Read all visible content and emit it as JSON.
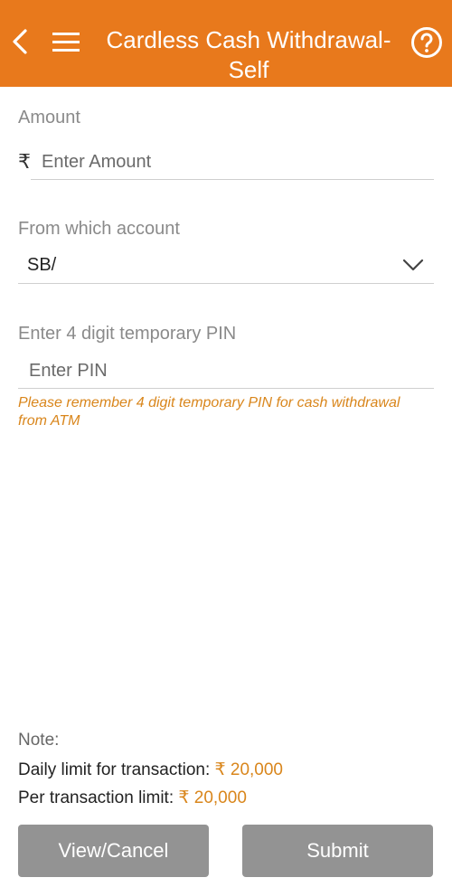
{
  "header": {
    "title": "Cardless Cash Withdrawal- Self",
    "back_icon": "chevron-left-icon",
    "menu_icon": "hamburger-menu-icon",
    "help_icon": "help-circle-icon",
    "bg_color": "#e8791c"
  },
  "amount": {
    "label": "Amount",
    "currency_symbol": "₹",
    "placeholder": "Enter Amount"
  },
  "account": {
    "label": "From which account",
    "selected": "SB/"
  },
  "pin": {
    "label": "Enter 4 digit temporary PIN",
    "placeholder": "Enter PIN",
    "hint": "Please remember 4 digit temporary PIN for cash withdrawal from ATM"
  },
  "note": {
    "label": "Note:",
    "daily_label": "Daily limit for transaction:",
    "daily_value": "₹ 20,000",
    "per_label": "Per transaction limit:",
    "per_value": "₹ 20,000"
  },
  "buttons": {
    "view_cancel": "View/Cancel",
    "submit": "Submit"
  }
}
